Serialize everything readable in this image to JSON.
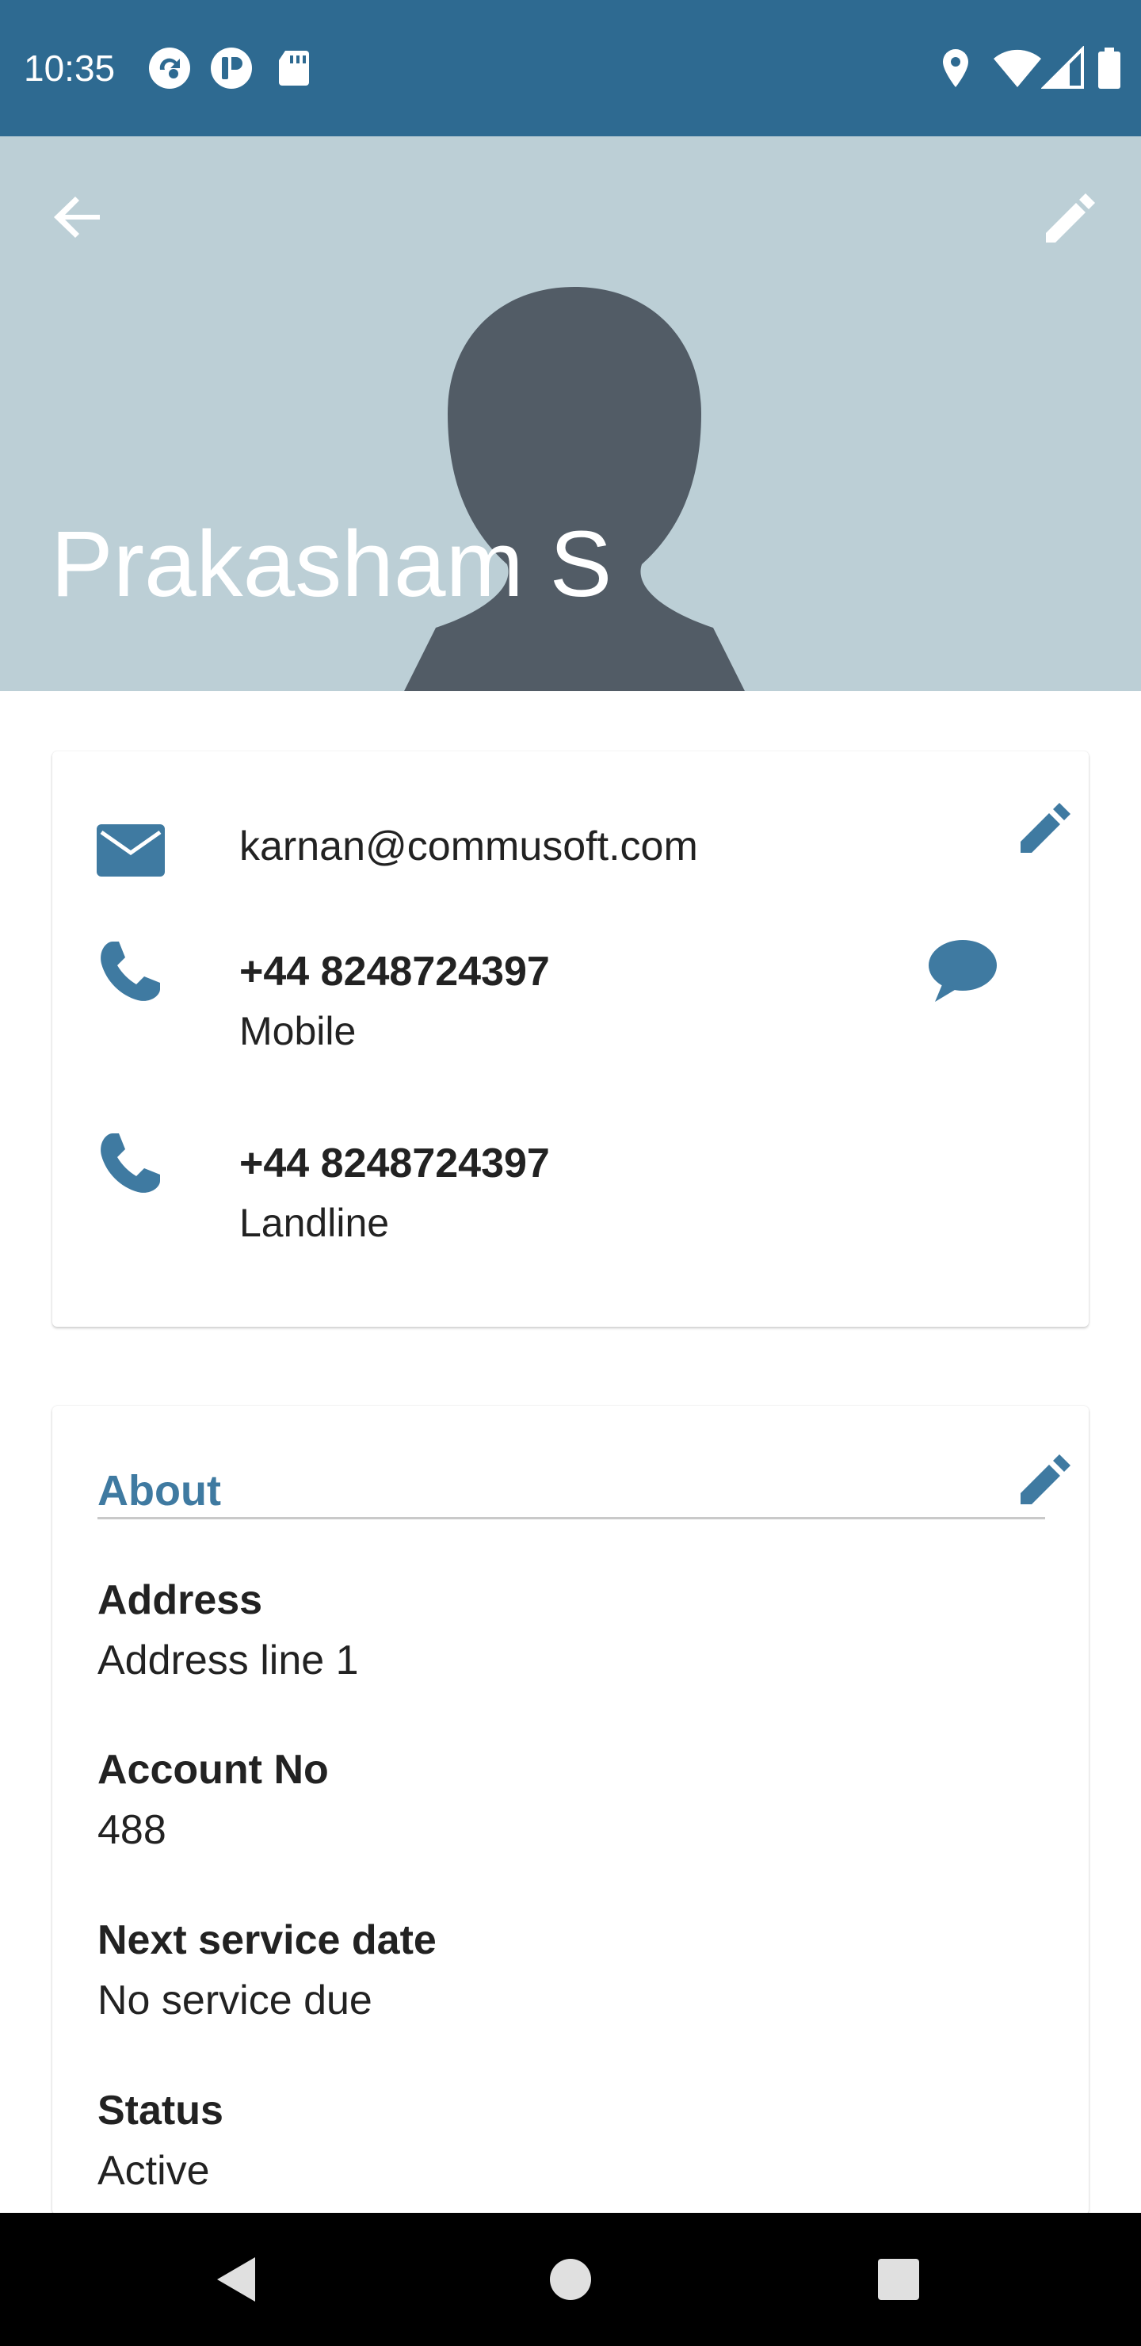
{
  "status_bar": {
    "time": "10:35",
    "icons": [
      "sync-icon",
      "app-badge-icon",
      "sd-card-icon",
      "location-icon",
      "wifi-icon",
      "signal-icon",
      "battery-icon"
    ]
  },
  "header": {
    "contact_name": "Prakasham S",
    "background_color": "#bccfd6",
    "icons": [
      "back-arrow-icon",
      "edit-pencil-icon",
      "avatar-silhouette-icon"
    ]
  },
  "contact_card": {
    "email": "karnan@commusoft.com",
    "phones": [
      {
        "number": "+44 8248724397",
        "type": "Mobile"
      },
      {
        "number": "+44 8248724397",
        "type": "Landline"
      }
    ],
    "accent_color": "#3f7aa1"
  },
  "about_card": {
    "title": "About",
    "fields": [
      {
        "label": "Address",
        "value": "Address line 1"
      },
      {
        "label": "Account No",
        "value": "488"
      },
      {
        "label": "Next service date",
        "value": "No service due"
      },
      {
        "label": "Status",
        "value": "Active"
      }
    ]
  },
  "nav_bar": {
    "icons": [
      "nav-back-icon",
      "nav-home-icon",
      "nav-recents-icon"
    ]
  }
}
